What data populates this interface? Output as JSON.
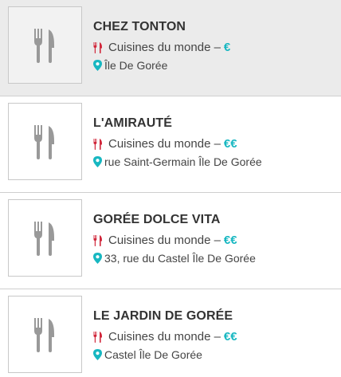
{
  "restaurants": [
    {
      "name": "CHEZ TONTON",
      "cuisine": "Cuisines du monde –",
      "price": "€",
      "address": "Île De Gorée",
      "selected": true
    },
    {
      "name": "L'AMIRAUTÉ",
      "cuisine": "Cuisines du monde –",
      "price": "€€",
      "address": "rue Saint-Germain Île De Gorée",
      "selected": false
    },
    {
      "name": "GORÉE DOLCE VITA",
      "cuisine": "Cuisines du monde –",
      "price": "€€",
      "address": "33, rue du Castel Île De Gorée",
      "selected": false
    },
    {
      "name": "LE JARDIN DE GORÉE",
      "cuisine": "Cuisines du monde –",
      "price": "€€",
      "address": "Castel Île De Gorée",
      "selected": false
    }
  ],
  "colors": {
    "price_accent": "#17b7c1",
    "pin_icon": "#17b7c1",
    "fork_icon": "#d0263a",
    "placeholder_icon": "#999999",
    "selected_background": "#ebebeb"
  },
  "icons": {
    "placeholder": "fork-knife-icon",
    "cuisine": "fork-knife-icon",
    "address": "map-pin-icon"
  }
}
